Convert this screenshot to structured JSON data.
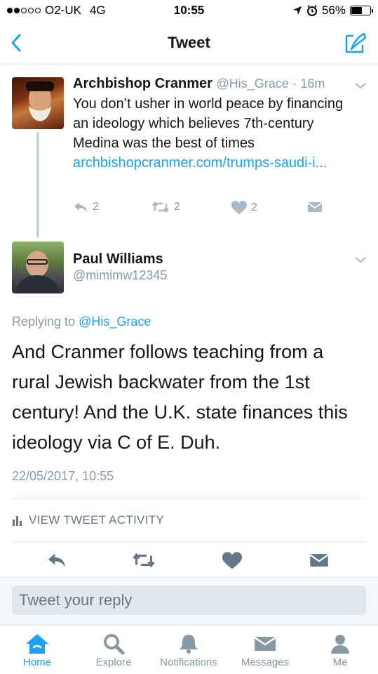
{
  "status_bar": {
    "carrier": "O2-UK",
    "network": "4G",
    "time": "10:55",
    "battery": "56%",
    "battery_level": 0.56
  },
  "nav": {
    "title": "Tweet",
    "back_icon": "chevron-left-icon",
    "compose_icon": "compose-tweet-icon"
  },
  "quoted_tweet": {
    "name": "Archbishop Cranmer",
    "handle": "@His_Grace",
    "time": "· 16m",
    "text": "You don’t usher in world peace by financing an ideology which believes 7th-century Medina was the best of times ",
    "link": "archbishopcranmer.com/trumps-saudi-i...",
    "reply_count": "2",
    "retweet_count": "2",
    "like_count": "2"
  },
  "main_tweet": {
    "name": "Paul Williams",
    "handle": "@mimimw12345",
    "replying_prefix": "Replying to ",
    "replying_handle": "@His_Grace",
    "text": "And Cranmer follows teaching from a rural Jewish backwater from the 1st century! And the U.K. state finances this ideology via C of E. Duh.",
    "timestamp": "22/05/2017, 10:55",
    "activity_label": "VIEW TWEET ACTIVITY"
  },
  "reply": {
    "placeholder": "Tweet your reply"
  },
  "tabs": [
    {
      "label": "Home",
      "icon": "home-icon",
      "active": true
    },
    {
      "label": "Explore",
      "icon": "search-icon",
      "active": false
    },
    {
      "label": "Notifications",
      "icon": "bell-icon",
      "active": false
    },
    {
      "label": "Messages",
      "icon": "envelope-icon",
      "active": false
    },
    {
      "label": "Me",
      "icon": "person-icon",
      "active": false
    }
  ],
  "colors": {
    "accent": "#1da1f2",
    "muted": "#8899a6",
    "text": "#14171a"
  }
}
